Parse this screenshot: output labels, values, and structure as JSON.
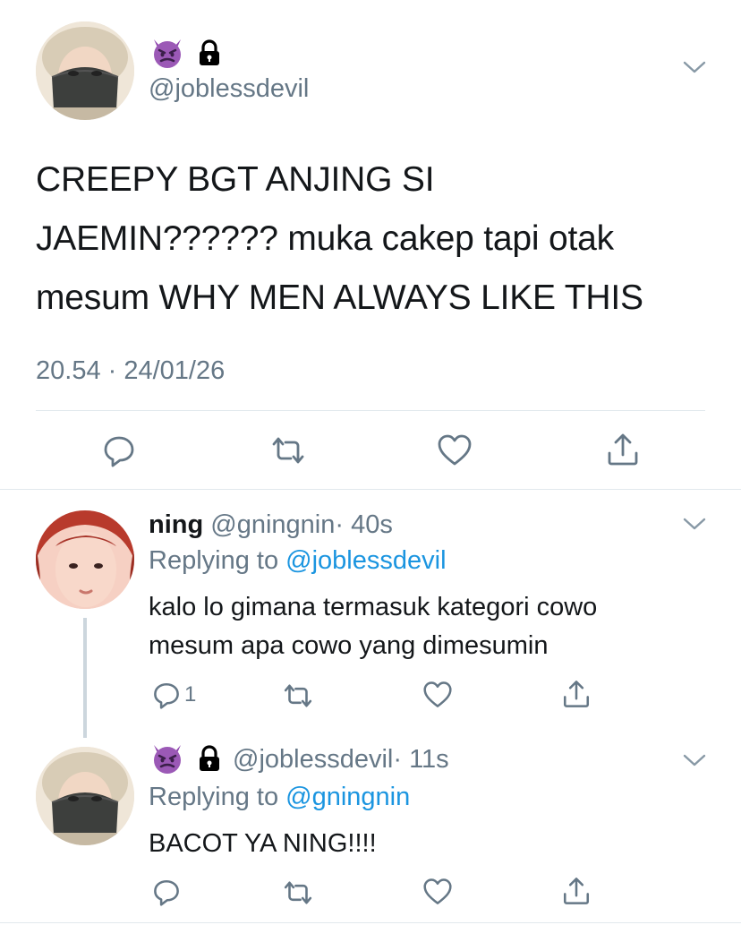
{
  "main_tweet": {
    "name_emoji": "😈",
    "handle": "@joblessdevil",
    "text_lines": [
      "CREEPY BGT ANJING SI",
      "JAEMIN?????? muka cakep tapi otak",
      "mesum WHY MEN ALWAYS LIKE THIS"
    ],
    "timestamp": "20.54 · 24/01/26"
  },
  "reply1": {
    "name": "ning",
    "handle": "@gningnin",
    "time": "· 40s",
    "replying_prefix": "Replying to",
    "replying_to": "@joblessdevil",
    "text_lines": [
      "kalo lo gimana termasuk kategori cowo",
      "mesum apa cowo yang dimesumin"
    ],
    "reply_count": "1"
  },
  "reply2": {
    "name_emoji": "😈",
    "handle": "@joblessdevil",
    "time": "· 11s",
    "replying_prefix": "Replying to",
    "replying_to": "@gningnin",
    "text": "BACOT YA NING!!!!"
  },
  "icons": [
    "devil-emoji",
    "lock-icon",
    "chevron-down-icon",
    "reply-icon",
    "retweet-icon",
    "like-icon",
    "share-icon"
  ],
  "colors": {
    "text": "#14171a",
    "muted": "#657786",
    "link": "#1b95e0",
    "divider": "#e1e8ed",
    "devil": "#9b59b6"
  }
}
